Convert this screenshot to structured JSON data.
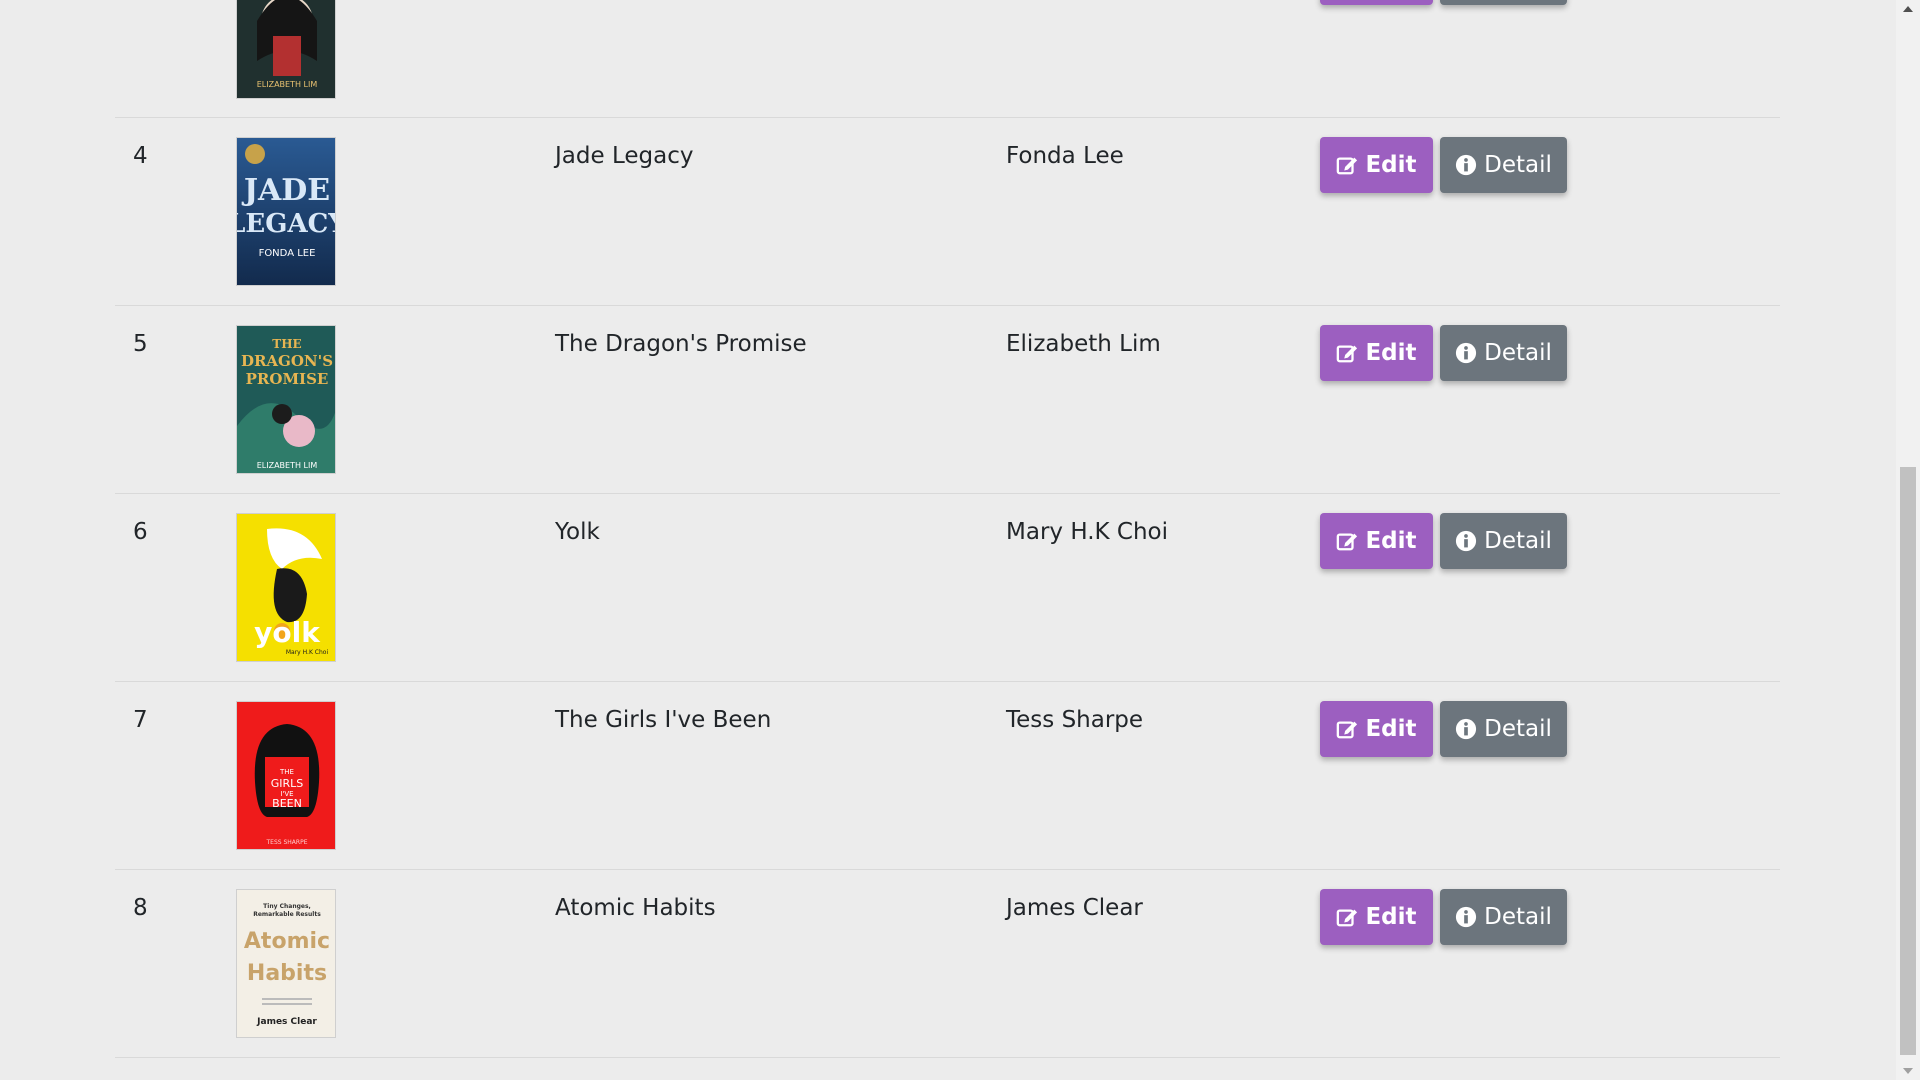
{
  "buttons": {
    "edit_label": "Edit",
    "detail_label": "Detail"
  },
  "books": [
    {
      "num": "",
      "title": "",
      "author": "",
      "cover": {
        "bg": "#1f2b2e",
        "accent": "#c73a3a",
        "text": "ELIZABETH LIM",
        "text_color": "#e8c170"
      }
    },
    {
      "num": "4",
      "title": "Jade Legacy",
      "author": "Fonda Lee",
      "cover": {
        "bg": "#1c3d6a",
        "accent": "#3a6fb0",
        "text": "JADE LEGACY",
        "text_color": "#cfe0f5",
        "sub": "FONDA LEE"
      }
    },
    {
      "num": "5",
      "title": "The Dragon's Promise",
      "author": "Elizabeth Lim",
      "cover": {
        "bg": "#1f5a57",
        "accent": "#3e8a78",
        "text": "THE DRAGON'S PROMISE",
        "text_color": "#e6b552",
        "sub": "ELIZABETH LIM"
      }
    },
    {
      "num": "6",
      "title": "Yolk",
      "author": "Mary H.K Choi",
      "cover": {
        "bg": "#f5e000",
        "accent": "#1a1a1a",
        "text": "yolk",
        "text_color": "#ffffff",
        "sub": "Mary H.K Choi"
      }
    },
    {
      "num": "7",
      "title": "The Girls I've Been",
      "author": "Tess Sharpe",
      "cover": {
        "bg": "#ef1b1b",
        "accent": "#111111",
        "text": "THE GIRLS I'VE BEEN",
        "text_color": "#ffffff",
        "sub": "TESS SHARPE"
      }
    },
    {
      "num": "8",
      "title": "Atomic Habits",
      "author": "James Clear",
      "cover": {
        "bg": "#f3efe6",
        "accent": "#c8a36a",
        "text": "Atomic Habits",
        "text_color": "#c8a36a",
        "top": "Tiny Changes, Remarkable Results",
        "sub": "James Clear"
      }
    }
  ],
  "colors": {
    "edit": "#9c5fc0",
    "detail": "#6c757d",
    "background": "#ececec"
  }
}
